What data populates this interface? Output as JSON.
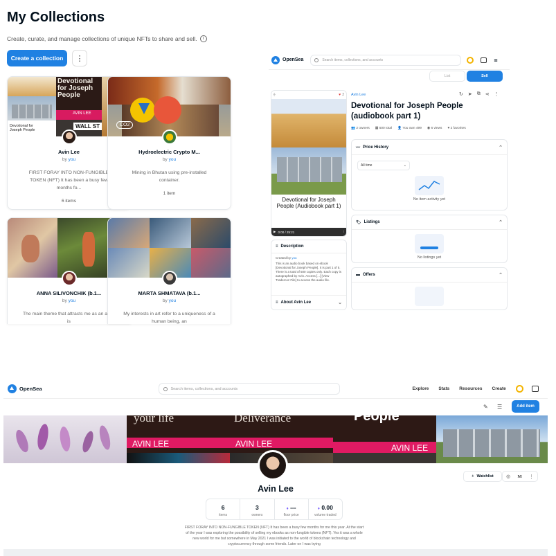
{
  "collections": {
    "title": "My Collections",
    "subtitle": "Create, curate, and manage collections of unique NFTs to share and sell.",
    "create_button": "Create a collection",
    "more_button": "⋮",
    "by_label": "by",
    "you_label": "you",
    "cards": [
      {
        "name": "Avin Lee",
        "desc": "FIRST FORAY INTO NON-FUNGIBLE TOKEN (NFT) It has been a busy few months fo...",
        "count": "6 items",
        "banner_text_1": "Devotional for Joseph People",
        "banner_text_2": "AVIN LEE",
        "banner_text_3": "WALL ST",
        "banner_caption": "Devotional for Joseph People"
      },
      {
        "name": "Hydroelectric Crypto M...",
        "desc": "Mining in Bhutan using pre-installed container.",
        "count": "1 item",
        "banner_text_1": "CO2"
      },
      {
        "name": "ANNA SILIVONCHIK (b.1...",
        "desc": "The main theme that attracts me as an artist is"
      },
      {
        "name": "MARTA SHMATAVA (b.1...",
        "desc": "My interests in art refer to a uniqueness of a human being, an"
      }
    ]
  },
  "asset": {
    "brand": "OpenSea",
    "search_placeholder": "Search items, collections, and accounts",
    "list_label": "List",
    "sell_label": "Sell",
    "collection": "Avin Lee",
    "title": "Devotional for Joseph People (audiobook part 1)",
    "owners": "2 owners",
    "total": "500 total",
    "you_own": "You own 499",
    "views": "6 views",
    "favorites": "2 favorites",
    "heart_count": "2",
    "price_history": "Price History",
    "time_filter": "All time",
    "no_activity": "No item activity yet",
    "listings": "Listings",
    "no_listings": "No listings yet",
    "offers": "Offers",
    "cover_text": "Devotional for Joseph People (Audiobook part 1)",
    "player_time": "0:00 / 25:21",
    "description_label": "Description",
    "created_by": "Created by",
    "created_by_you": "you",
    "description_text": "This is an audio book based on ebook [Devotional for Joseph People]. It is part 1 of 5. There is a total of 500 copies only. Each copy is autographed by Avin. Access [...] [View Tradercoz File] to access the audio file.",
    "about_label": "About Avin Lee"
  },
  "profile": {
    "brand": "OpenSea",
    "search_placeholder": "Search items, collections, and accounts",
    "nav": [
      "Explore",
      "Stats",
      "Resources",
      "Create"
    ],
    "add_item": "Add item",
    "banner_texts": [
      "your life",
      "Deliverance",
      "People"
    ],
    "banner_author": "AVIN LEE",
    "watchlist": "Watchlist",
    "name": "Avin Lee",
    "stats": [
      {
        "value": "6",
        "label": "items"
      },
      {
        "value": "3",
        "label": "owners"
      },
      {
        "value": "---",
        "label": "floor price"
      },
      {
        "value": "0.00",
        "label": "volume traded"
      }
    ],
    "bio": "FIRST FORAY INTO NON-FUNGIBLE TOKEN (NFT) It has been a busy few months for me this year. At the start of the year I was exploring the possibility of selling my ebooks as non-fungible tokens (NFT). Yes it was a whole new world for me but somewhere in May 2021 I was initiated to the world of blockchain technology and cryptocurrency through some friends. Later on I was trying"
  }
}
